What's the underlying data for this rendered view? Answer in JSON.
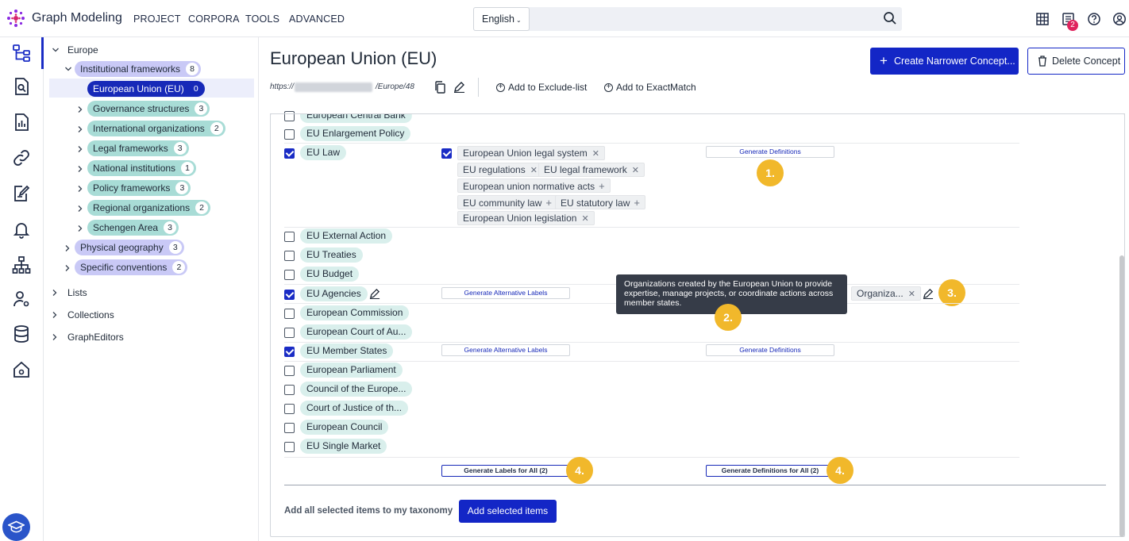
{
  "header": {
    "brand": "Graph Modeling",
    "nav": [
      "PROJECT",
      "CORPORA",
      "TOOLS",
      "ADVANCED"
    ],
    "language": "English",
    "notification_count": "2"
  },
  "tree": {
    "root": "Europe",
    "institutional": {
      "label": "Institutional frameworks",
      "count": "8"
    },
    "children": [
      {
        "label": "European Union (EU)",
        "count": "0"
      },
      {
        "label": "Governance structures",
        "count": "3"
      },
      {
        "label": "International organizations",
        "count": "2"
      },
      {
        "label": "Legal frameworks",
        "count": "3"
      },
      {
        "label": "National institutions",
        "count": "1"
      },
      {
        "label": "Policy frameworks",
        "count": "3"
      },
      {
        "label": "Regional organizations",
        "count": "2"
      },
      {
        "label": "Schengen Area",
        "count": "3"
      }
    ],
    "physical": {
      "label": "Physical geography",
      "count": "3"
    },
    "specific": {
      "label": "Specific conventions",
      "count": "2"
    },
    "others": [
      "Lists",
      "Collections",
      "GraphEditors"
    ]
  },
  "concept": {
    "title": "European Union (EU)",
    "url_prefix": "https://",
    "url_suffix": "/Europe/48",
    "create_button": "Create Narrower Concept...",
    "delete_button": "Delete Concept",
    "exclude_link": "Add to Exclude-list",
    "exact_link": "Add to ExactMatch"
  },
  "items": [
    {
      "label": "European Central Bank",
      "checked": false
    },
    {
      "label": "EU Enlargement Policy",
      "checked": false
    },
    {
      "label": "EU Law",
      "checked": true
    },
    {
      "label": "EU External Action",
      "checked": false
    },
    {
      "label": "EU Treaties",
      "checked": false
    },
    {
      "label": "EU Budget",
      "checked": false
    },
    {
      "label": "EU Agencies",
      "checked": true
    },
    {
      "label": "European Commission",
      "checked": false
    },
    {
      "label": "European Court of Au...",
      "checked": false
    },
    {
      "label": "EU Member States",
      "checked": true
    },
    {
      "label": "European Parliament",
      "checked": false
    },
    {
      "label": "Council of the Europe...",
      "checked": false
    },
    {
      "label": "Court of Justice of th...",
      "checked": false
    },
    {
      "label": "European Council",
      "checked": false
    },
    {
      "label": "EU Single Market",
      "checked": false
    }
  ],
  "eu_law_chips": [
    {
      "label": "European Union legal system",
      "action": "remove"
    },
    {
      "label": "EU regulations",
      "action": "remove"
    },
    {
      "label": "EU legal framework",
      "action": "remove"
    },
    {
      "label": "European union normative acts",
      "action": "add"
    },
    {
      "label": "EU community law",
      "action": "add"
    },
    {
      "label": "EU statutory law",
      "action": "add"
    },
    {
      "label": "European Union legislation",
      "action": "remove"
    }
  ],
  "buttons": {
    "gen_definitions": "Generate Definitions",
    "gen_alt_labels": "Generate Alternative Labels",
    "gen_labels_all": "Generate Labels for All (2)",
    "gen_defs_all": "Generate Definitions for All (2)",
    "add_selected": "Add selected items",
    "footer_label": "Add all selected items to my taxonomy"
  },
  "agencies_chip": "Organiza...",
  "tooltip": "Organizations created by the European Union to provide expertise, manage projects, or coordinate actions across member states.",
  "callouts": [
    "1.",
    "2.",
    "3.",
    "4.",
    "4."
  ],
  "colors": {
    "primary": "#1326c6",
    "teal_pill": "#a8dcd6",
    "lavender_pill": "#c9c9f6",
    "callout": "#f1b82b"
  }
}
